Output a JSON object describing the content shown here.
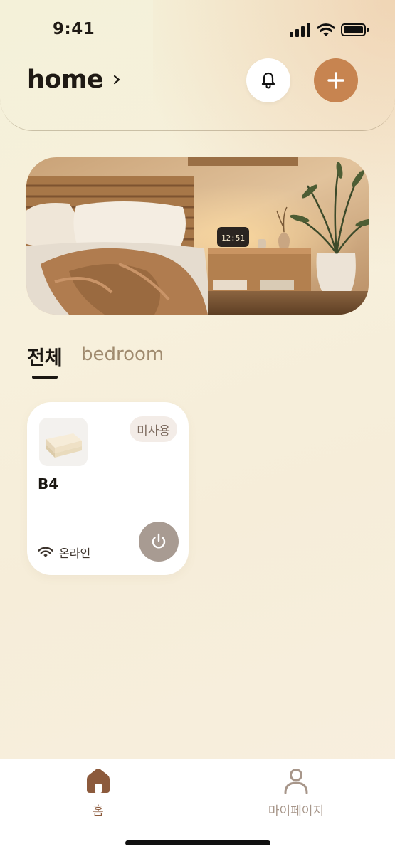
{
  "status_bar": {
    "time": "9:41"
  },
  "header": {
    "title": "home"
  },
  "tabs": [
    {
      "label": "전체",
      "active": true
    },
    {
      "label": "bedroom",
      "active": false
    }
  ],
  "devices": [
    {
      "name": "B4",
      "badge": "미사용",
      "connection": "온라인"
    }
  ],
  "bottom_nav": {
    "home_label": "홈",
    "mypage_label": "마이페이지"
  },
  "colors": {
    "accent": "#c78450",
    "nav_active": "#8c5a3c",
    "nav_inactive": "#a7968a",
    "power_button": "#a89b92"
  },
  "icons": {
    "bell": "bell-icon",
    "add": "plus-icon",
    "power": "power-icon",
    "wifi": "wifi-icon",
    "home": "home-icon",
    "person": "person-icon"
  }
}
